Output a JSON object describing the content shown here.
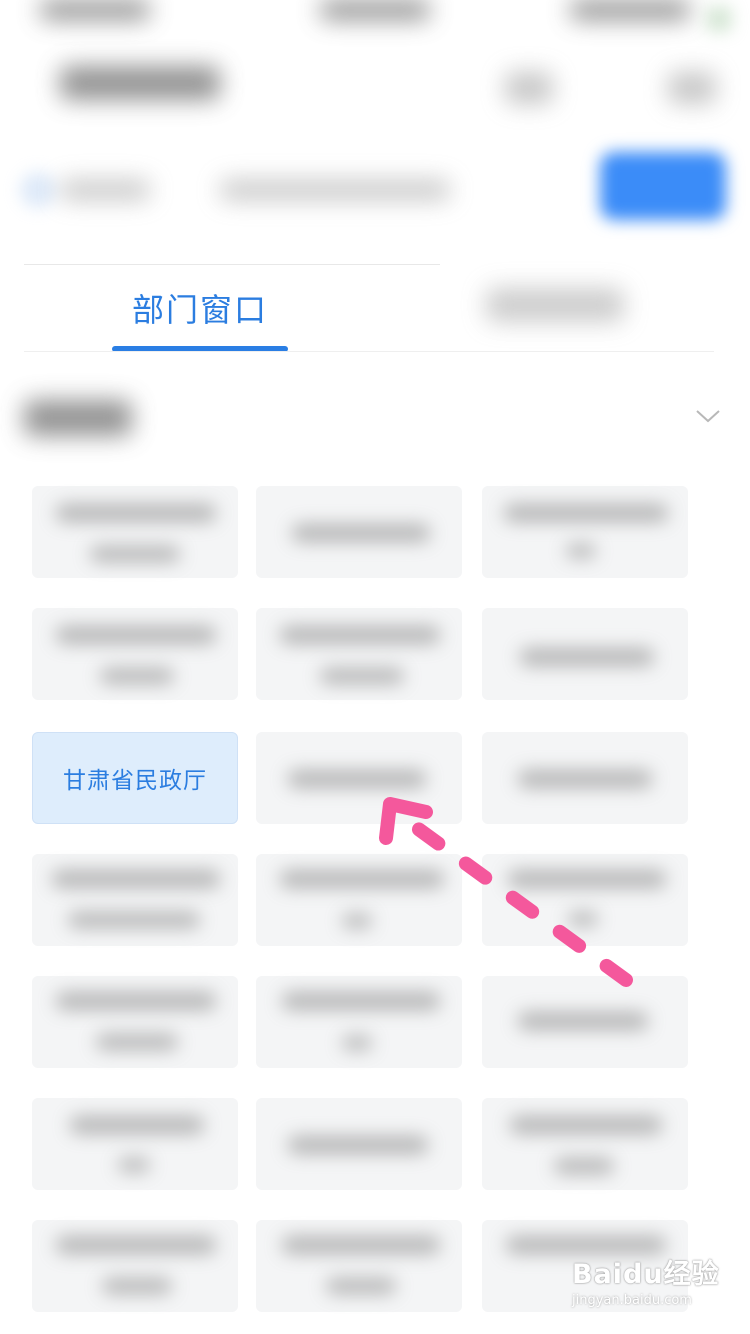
{
  "tabs": {
    "active_label": "部门窗口"
  },
  "departments": {
    "selected_label": "甘肃省民政厅"
  },
  "watermark": {
    "line1": "Baidu经验",
    "line2": "jingyan.baidu.com"
  },
  "colors": {
    "accent": "#2a7ee4",
    "selected_bg": "#deedfc",
    "primary_button": "#3b8cf8",
    "annotation_arrow": "#f4589c"
  },
  "icons": {
    "dropdown": "chevron-down-icon",
    "search_location": "location-icon",
    "annotation": "dashed-arrow-icon"
  }
}
